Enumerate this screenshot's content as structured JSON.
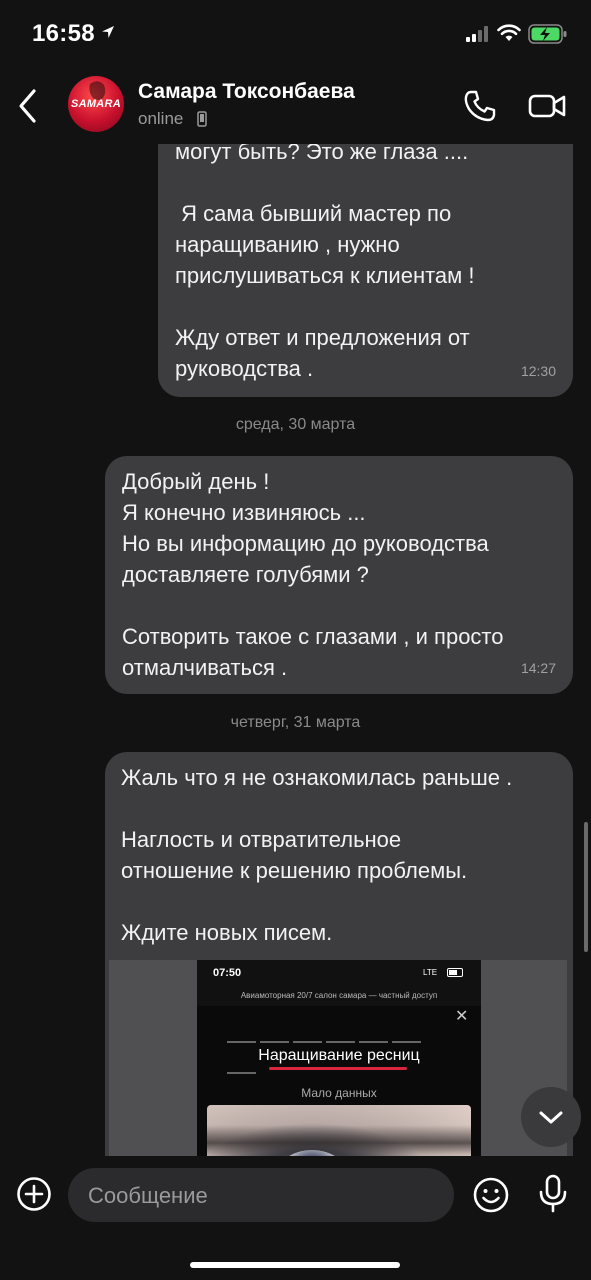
{
  "status_bar": {
    "time": "16:58",
    "icons": [
      "location-arrow-icon",
      "signal-icon",
      "wifi-icon",
      "battery-charging-icon"
    ],
    "battery_color": "#4cd964"
  },
  "header": {
    "contact_name": "Самара Токсонбаева",
    "status": "online",
    "avatar_text": "SAMARA",
    "icons": [
      "back-chevron-icon",
      "phone-icon",
      "video-camera-icon"
    ]
  },
  "messages": [
    {
      "lines": [
        "могут быть? Это же глаза ....",
        "",
        " Я сама бывший мастер по",
        "наращиванию , нужно",
        "прислушиваться к клиентам !",
        "",
        "Жду ответ и предложения от",
        "руководства ."
      ],
      "time": "12:30"
    },
    {
      "date_separator": "среда, 30 марта",
      "lines": [
        "Добрый день !",
        "Я конечно извиняюсь ...",
        "Но вы информацию до руководства",
        "доставляете голубями ?",
        "",
        "Сотворить такое с глазами , и просто",
        "отмалчиваться ."
      ],
      "time": "14:27"
    },
    {
      "date_separator": "четверг, 31 марта",
      "lines": [
        "Жаль что я не ознакомилась раньше .",
        "",
        "Наглость и отвратительное",
        "отношение к решению проблемы.",
        "",
        "Ждите новых писем."
      ],
      "attachment": {
        "time": "07:50",
        "network": "LTE",
        "url": "Авиамоторная 20/7 салон самара — частный доступ",
        "title": "Наращивание ресниц",
        "subtitle": "Мало данных"
      }
    }
  ],
  "input": {
    "placeholder": "Сообщение",
    "icons": [
      "plus-circle-icon",
      "emoji-icon",
      "microphone-icon"
    ]
  },
  "colors": {
    "background": "#121212",
    "bubble": "#3d3d40",
    "accent_red": "#d7263d"
  }
}
